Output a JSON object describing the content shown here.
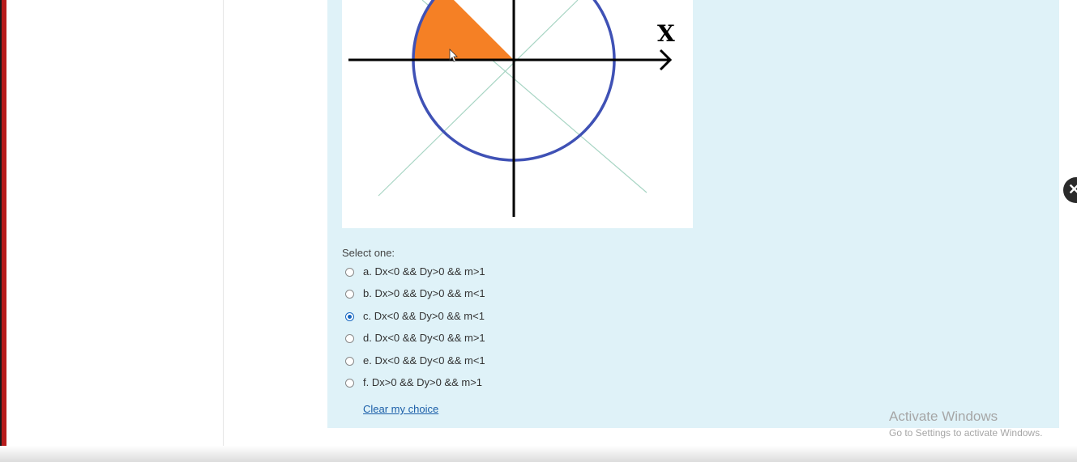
{
  "figure": {
    "axis_label_x": "X"
  },
  "question": {
    "prompt": "Select one:",
    "options": [
      {
        "label": "a. Dx<0 && Dy>0 && m>1",
        "selected": false
      },
      {
        "label": "b. Dx>0 && Dy>0 && m<1",
        "selected": false
      },
      {
        "label": "c. Dx<0 && Dy>0 && m<1",
        "selected": true
      },
      {
        "label": "d. Dx<0 && Dy<0 && m>1",
        "selected": false
      },
      {
        "label": "e. Dx<0 && Dy<0 && m<1",
        "selected": false
      },
      {
        "label": "f. Dx>0 && Dy>0 && m>1",
        "selected": false
      }
    ],
    "clear_label": "Clear my choice"
  },
  "watermark": {
    "title": "Activate Windows",
    "subtitle": "Go to Settings to activate Windows."
  },
  "close_icon": "close-icon",
  "colors": {
    "panel_bg": "#dff2f8",
    "circle": "#3f51b5",
    "sector": "#f58025",
    "diagonal": "#a8d5c4",
    "accent": "#1565c0"
  }
}
